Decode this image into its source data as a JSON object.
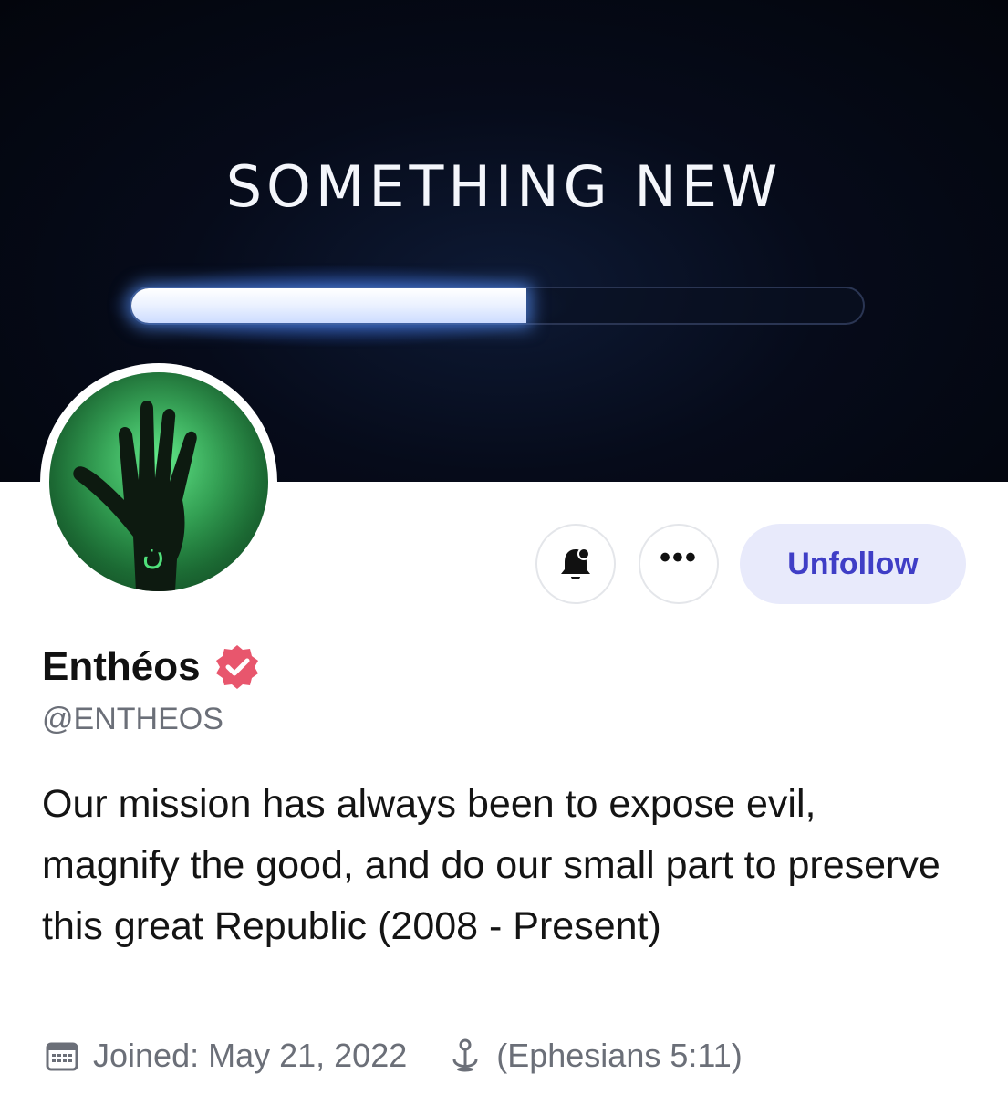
{
  "banner": {
    "headline": "SOMETHING NEW",
    "progress_fraction": 0.54
  },
  "actions": {
    "notify_icon": "bell-icon",
    "more_label": "•••",
    "unfollow_label": "Unfollow"
  },
  "profile": {
    "display_name": "Enthéos",
    "verified_icon": "verified-badge-icon",
    "handle": "@ENTHEOS",
    "bio": "Our mission has always been to expose evil, magnify the good, and do our small part to preserve this great Republic (2008 - Present)",
    "joined": "Joined: May 21, 2022",
    "location": "(Ephesians 5:11)"
  },
  "colors": {
    "accent": "#3f3ec6",
    "accent_bg": "#e8eafb",
    "verified": "#e8566d",
    "muted": "#6b6f78"
  }
}
